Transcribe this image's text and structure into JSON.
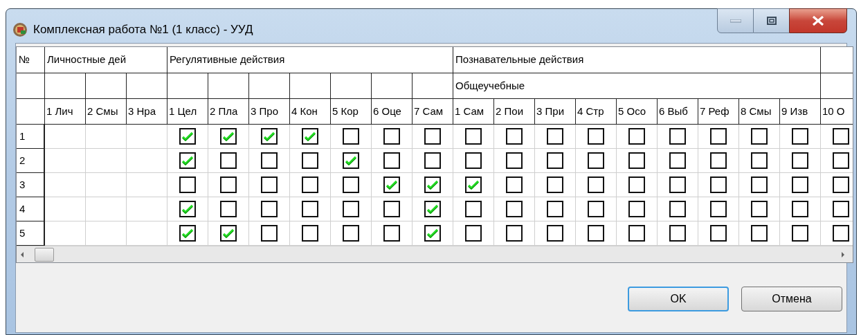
{
  "window": {
    "title": "Комплексная работа №1 (1 класс) - УУД"
  },
  "table": {
    "number_header": "№",
    "groups": [
      {
        "label": "Личностные дей",
        "columns": [
          {
            "label": "1 Лич",
            "kind": "blank"
          },
          {
            "label": "2 Смы",
            "kind": "blank"
          },
          {
            "label": "3 Нра",
            "kind": "blank"
          }
        ]
      },
      {
        "label": "Регулятивные действия",
        "columns": [
          {
            "label": "1 Цел",
            "kind": "checkbox"
          },
          {
            "label": "2 Пла",
            "kind": "checkbox"
          },
          {
            "label": "3 Про",
            "kind": "checkbox"
          },
          {
            "label": "4 Кон",
            "kind": "checkbox"
          },
          {
            "label": "5 Кор",
            "kind": "checkbox"
          },
          {
            "label": "6 Оце",
            "kind": "checkbox"
          },
          {
            "label": "7 Сам",
            "kind": "checkbox"
          }
        ]
      },
      {
        "label": "Познавательные действия",
        "subgroup": "Общеучебные",
        "columns": [
          {
            "label": "1 Сам",
            "kind": "checkbox"
          },
          {
            "label": "2 Пои",
            "kind": "checkbox"
          },
          {
            "label": "3 При",
            "kind": "checkbox"
          },
          {
            "label": "4 Стр",
            "kind": "checkbox"
          },
          {
            "label": "5 Осо",
            "kind": "checkbox"
          },
          {
            "label": "6 Выб",
            "kind": "checkbox"
          },
          {
            "label": "7 Реф",
            "kind": "checkbox"
          },
          {
            "label": "8 Смы",
            "kind": "checkbox"
          },
          {
            "label": "9 Изв",
            "kind": "checkbox"
          }
        ]
      },
      {
        "columns": [
          {
            "label": "10 О",
            "kind": "checkbox"
          }
        ]
      }
    ],
    "rows": [
      {
        "number": "1",
        "checked": [
          true,
          true,
          true,
          true,
          false,
          false,
          false,
          false,
          false,
          false,
          false,
          false,
          false,
          false,
          false,
          false,
          false
        ]
      },
      {
        "number": "2",
        "checked": [
          true,
          false,
          false,
          false,
          true,
          false,
          false,
          false,
          false,
          false,
          false,
          false,
          false,
          false,
          false,
          false,
          false
        ]
      },
      {
        "number": "3",
        "checked": [
          false,
          false,
          false,
          false,
          false,
          true,
          true,
          true,
          false,
          false,
          false,
          false,
          false,
          false,
          false,
          false,
          false
        ]
      },
      {
        "number": "4",
        "checked": [
          true,
          false,
          false,
          false,
          false,
          false,
          true,
          false,
          false,
          false,
          false,
          false,
          false,
          false,
          false,
          false,
          false
        ]
      },
      {
        "number": "5",
        "checked": [
          true,
          true,
          false,
          false,
          false,
          false,
          true,
          false,
          false,
          false,
          false,
          false,
          false,
          false,
          false,
          false,
          false
        ]
      }
    ]
  },
  "buttons": [
    {
      "label": "OK",
      "default": true
    },
    {
      "label": "Отмена",
      "default": false
    }
  ]
}
